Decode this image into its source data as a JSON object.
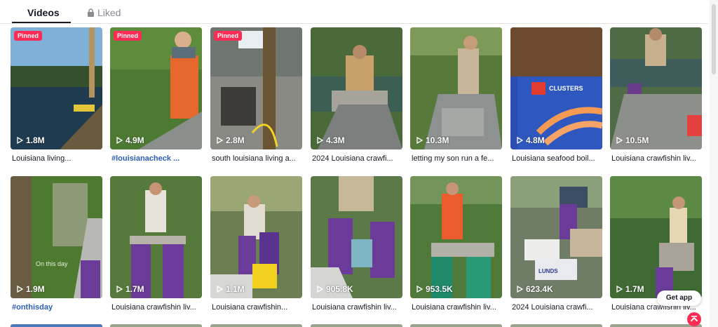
{
  "tabs": {
    "videos_label": "Videos",
    "liked_label": "Liked"
  },
  "videos": [
    {
      "pinned": "Pinned",
      "views": "1.8M",
      "caption": "Louisiana living...",
      "hashtag": false
    },
    {
      "pinned": "Pinned",
      "views": "4.9M",
      "caption": "#louisianacheck ...",
      "hashtag": true
    },
    {
      "pinned": "Pinned",
      "views": "2.8M",
      "caption": "south louisiana living a...",
      "hashtag": false
    },
    {
      "pinned": "",
      "views": "4.3M",
      "caption": "2024 Louisiana crawfi...",
      "hashtag": false
    },
    {
      "pinned": "",
      "views": "10.3M",
      "caption": "letting my son run a fe...",
      "hashtag": false
    },
    {
      "pinned": "",
      "views": "4.8M",
      "caption": "Louisiana seafood boil...",
      "hashtag": false
    },
    {
      "pinned": "",
      "views": "10.5M",
      "caption": "Louisiana crawfishin liv...",
      "hashtag": false
    },
    {
      "pinned": "",
      "views": "1.9M",
      "caption": "#onthisday",
      "hashtag": true
    },
    {
      "pinned": "",
      "views": "1.7M",
      "caption": "Louisiana crawfishin liv...",
      "hashtag": false
    },
    {
      "pinned": "",
      "views": "1.1M",
      "caption": "Louisiana crawfishin...",
      "hashtag": false
    },
    {
      "pinned": "",
      "views": "905.8K",
      "caption": "Louisiana crawfishin liv...",
      "hashtag": false
    },
    {
      "pinned": "",
      "views": "953.5K",
      "caption": "Louisiana crawfishin liv...",
      "hashtag": false
    },
    {
      "pinned": "",
      "views": "623.4K",
      "caption": "2024 Louisiana crawfi...",
      "hashtag": false
    },
    {
      "pinned": "",
      "views": "1.7M",
      "caption": "Louisiana crawfishin liv...",
      "hashtag": false
    }
  ],
  "thumb_overlays": {
    "clusters_sign": "CLUSTERS",
    "on_this_day": "On this day",
    "lunds": "LUNDS"
  },
  "floating": {
    "get_app": "Get app"
  },
  "colors": {
    "accent": "#fe2c55",
    "hashtag": "#2b5db9",
    "text": "#161823",
    "muted": "#8a8b91"
  },
  "icons": {
    "lock": "lock-icon",
    "play": "play-icon",
    "scroll_top": "arrow-up-icon"
  }
}
